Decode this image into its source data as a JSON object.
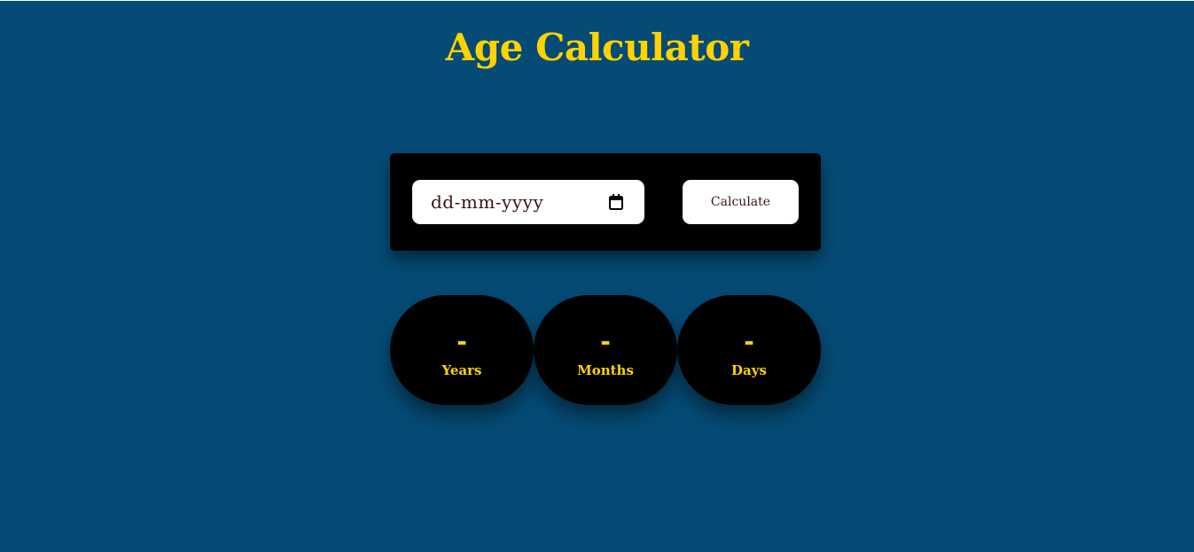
{
  "page": {
    "title": "Age Calculator"
  },
  "form": {
    "date_placeholder": "dd-mm-yyyy",
    "calendar_icon": "calendar-icon",
    "calculate_label": "Calculate"
  },
  "results": [
    {
      "value": "-",
      "label": "Years"
    },
    {
      "value": "-",
      "label": "Months"
    },
    {
      "value": "-",
      "label": "Days"
    }
  ],
  "colors": {
    "background": "#054b75",
    "accent": "#ffd200",
    "panel": "#000000",
    "input_background": "#ffffff",
    "input_text": "#3a1414"
  }
}
